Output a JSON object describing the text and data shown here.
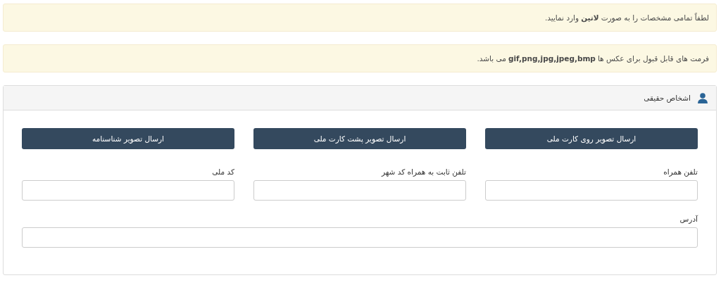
{
  "alerts": [
    "لطفاً تمامی مشخصات را به صورت **لاتین** وارد نمایید.",
    "فرمت های قابل قبول برای عکس ها**gif,png,jpg,jpeg,bmp** می باشد."
  ],
  "panel": {
    "title": "اشخاص حقیقی",
    "buttons": [
      "ارسال تصویر روی کارت ملی",
      "ارسال تصویر پشت کارت ملی",
      "ارسال تصویر شناسنامه"
    ],
    "fields": [
      {
        "label": "تلفن همراه"
      },
      {
        "label": "تلفن ثابت به همراه کد شهر"
      },
      {
        "label": "کد ملی"
      }
    ],
    "address_field": {
      "label": "آدرس"
    }
  }
}
